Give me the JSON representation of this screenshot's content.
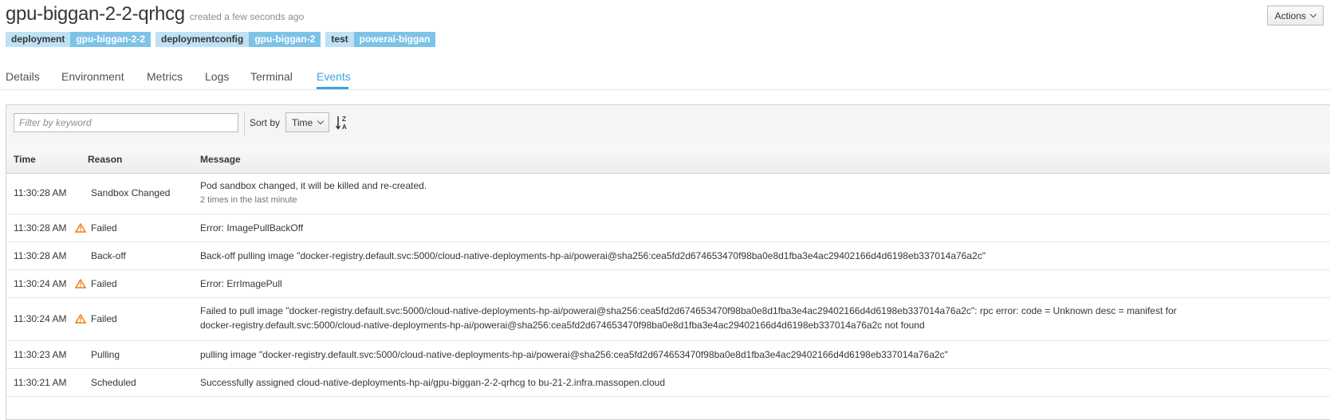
{
  "header": {
    "pod_name": "gpu-biggan-2-2-qrhcg",
    "created_text": "created a few seconds ago",
    "actions_label": "Actions"
  },
  "labels": [
    {
      "key": "deployment",
      "value": "gpu-biggan-2-2"
    },
    {
      "key": "deploymentconfig",
      "value": "gpu-biggan-2"
    },
    {
      "key": "test",
      "value": "powerai-biggan"
    }
  ],
  "tabs": [
    {
      "label": "Details"
    },
    {
      "label": "Environment"
    },
    {
      "label": "Metrics"
    },
    {
      "label": "Logs"
    },
    {
      "label": "Terminal"
    },
    {
      "label": "Events",
      "active": true
    }
  ],
  "toolbar": {
    "filter_placeholder": "Filter by keyword",
    "sort_by_label": "Sort by",
    "sort_value": "Time"
  },
  "table": {
    "columns": [
      "Time",
      "Reason",
      "Message"
    ],
    "rows": [
      {
        "time": "11:30:28 AM",
        "reason": "Sandbox Changed",
        "warning": false,
        "message": "Pod sandbox changed, it will be killed and re-created.",
        "sub": "2 times in the last minute"
      },
      {
        "time": "11:30:28 AM",
        "reason": "Failed",
        "warning": true,
        "message": "Error: ImagePullBackOff",
        "sub": ""
      },
      {
        "time": "11:30:28 AM",
        "reason": "Back-off",
        "warning": false,
        "message": "Back-off pulling image \"docker-registry.default.svc:5000/cloud-native-deployments-hp-ai/powerai@sha256:cea5fd2d674653470f98ba0e8d1fba3e4ac29402166d4d6198eb337014a76a2c\"",
        "sub": ""
      },
      {
        "time": "11:30:24 AM",
        "reason": "Failed",
        "warning": true,
        "message": "Error: ErrImagePull",
        "sub": ""
      },
      {
        "time": "11:30:24 AM",
        "reason": "Failed",
        "warning": true,
        "message": "Failed to pull image \"docker-registry.default.svc:5000/cloud-native-deployments-hp-ai/powerai@sha256:cea5fd2d674653470f98ba0e8d1fba3e4ac29402166d4d6198eb337014a76a2c\": rpc error: code = Unknown desc = manifest for docker-registry.default.svc:5000/cloud-native-deployments-hp-ai/powerai@sha256:cea5fd2d674653470f98ba0e8d1fba3e4ac29402166d4d6198eb337014a76a2c not found",
        "sub": ""
      },
      {
        "time": "11:30:23 AM",
        "reason": "Pulling",
        "warning": false,
        "message": "pulling image \"docker-registry.default.svc:5000/cloud-native-deployments-hp-ai/powerai@sha256:cea5fd2d674653470f98ba0e8d1fba3e4ac29402166d4d6198eb337014a76a2c\"",
        "sub": ""
      },
      {
        "time": "11:30:21 AM",
        "reason": "Scheduled",
        "warning": false,
        "message": "Successfully assigned cloud-native-deployments-hp-ai/gpu-biggan-2-2-qrhcg to bu-21-2.infra.massopen.cloud",
        "sub": ""
      }
    ]
  },
  "colors": {
    "accent": "#39a5dc",
    "label_key_bg": "#bee1f4",
    "label_value_bg": "#7dc3e8",
    "warning": "#ec7a08"
  }
}
